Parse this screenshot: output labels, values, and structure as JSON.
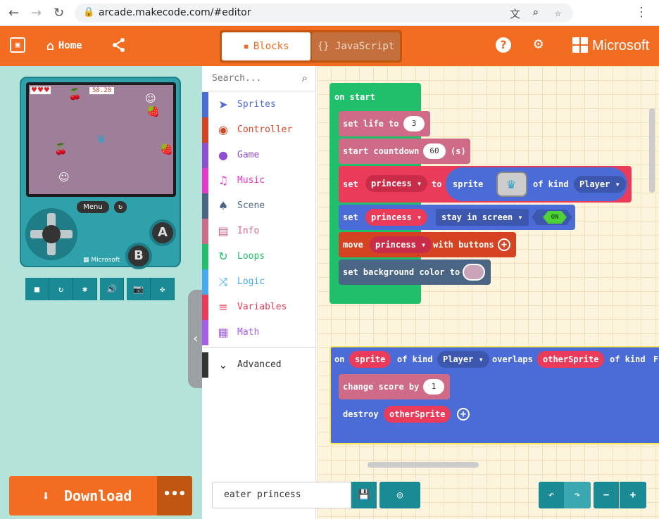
{
  "browser": {
    "url": "arcade.makecode.com/#editor",
    "back_icon": "←",
    "forward_icon": "→",
    "reload_icon": "↻",
    "lock_icon": "🔒",
    "translate_icon": "文",
    "zoom_icon": "⌕",
    "star_icon": "☆",
    "menu_icon": "⋮"
  },
  "topbar": {
    "home_label": "Home",
    "home_icon": "⌂",
    "share_icon": "⟨",
    "tab_blocks": "Blocks",
    "tab_javascript": "{} JavaScript",
    "help_icon": "?",
    "gear_icon": "⚙",
    "brand": "Microsoft",
    "accent": "#f26c22"
  },
  "simulator": {
    "hearts": "♥♥♥",
    "timer": "58.20",
    "menu_label": "Menu",
    "restart_icon": "↻",
    "button_a": "A",
    "button_b": "B",
    "device_brand": "Microsoft",
    "tools": [
      "■",
      "↻",
      "✱",
      "🔊",
      "📷",
      "✜"
    ],
    "download_label": "Download",
    "download_icon": "⬇",
    "more_label": "•••",
    "collapse_icon": "‹"
  },
  "toolbox": {
    "search_placeholder": "Search...",
    "categories": [
      {
        "label": "Sprites",
        "color": "#4b6cd6",
        "icon": "➤"
      },
      {
        "label": "Controller",
        "color": "#d54322",
        "icon": "◉"
      },
      {
        "label": "Game",
        "color": "#8f4fd1",
        "icon": "●"
      },
      {
        "label": "Music",
        "color": "#e63acb",
        "icon": "♫"
      },
      {
        "label": "Scene",
        "color": "#4b6584",
        "icon": "♠"
      },
      {
        "label": "Info",
        "color": "#cf6a87",
        "icon": "▤"
      },
      {
        "label": "Loops",
        "color": "#20bf6b",
        "icon": "↻"
      },
      {
        "label": "Logic",
        "color": "#45aaf2",
        "icon": "⤨"
      },
      {
        "label": "Variables",
        "color": "#eb3b5a",
        "icon": "≡"
      },
      {
        "label": "Math",
        "color": "#a55eea",
        "icon": "▦"
      }
    ],
    "advanced_label": "Advanced",
    "advanced_icon": "⌄"
  },
  "workspace": {
    "on_start": "on start",
    "set_life": "set life to",
    "life_value": "3",
    "start_countdown": "start countdown",
    "countdown_value": "60",
    "countdown_unit": "(s)",
    "set_label": "set",
    "var_princess": "princess",
    "to_label": "to",
    "sprite_label": "sprite",
    "of_kind": "of kind",
    "kind_player": "Player",
    "stay_in_screen": "stay in screen",
    "on_label": "ON",
    "move_label": "move",
    "with_buttons": "with buttons",
    "set_bg": "set background color to",
    "overlap_on": "on",
    "overlap_sprite": "sprite",
    "overlaps": "overlaps",
    "other_sprite": "otherSprite",
    "overlap_kind_tail": "of kind",
    "trailing": "F",
    "change_score": "change score by",
    "score_value": "1",
    "destroy_label": "destroy",
    "plus_icon": "+",
    "dropdown_icon": "▾",
    "colors": {
      "loops": "#20bf6b",
      "info": "#cf6a87",
      "variables": "#eb3b5a",
      "sprites": "#4b6cd6",
      "controller": "#d54322",
      "scene": "#4b6584"
    }
  },
  "bottombar": {
    "project_name": "eater princess",
    "save_icon": "💾",
    "github_icon": "◎",
    "undo_icon": "↶",
    "redo_icon": "↷",
    "zoom_out_icon": "−",
    "zoom_in_icon": "+"
  }
}
